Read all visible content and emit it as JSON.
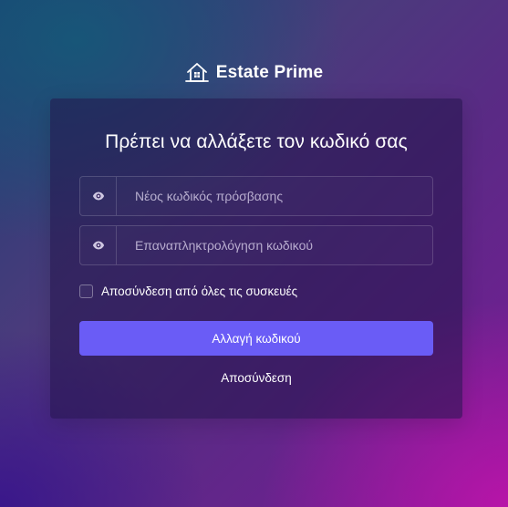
{
  "brand": {
    "name": "Estate Prime",
    "icon": "house-logo-icon"
  },
  "card": {
    "title": "Πρέπει να αλλάξετε τον κωδικό σας",
    "new_password": {
      "placeholder": "Νέος κωδικός πρόσβασης",
      "value": "",
      "icon": "eye-icon"
    },
    "confirm_password": {
      "placeholder": "Επαναπληκτρολόγηση κωδικού",
      "value": "",
      "icon": "eye-icon"
    },
    "logout_all": {
      "label": "Αποσύνδεση από όλες τις συσκευές",
      "checked": false
    },
    "submit_label": "Αλλαγή κωδικού",
    "logout_label": "Αποσύνδεση"
  },
  "colors": {
    "accent": "#6a5cf6",
    "text": "#ffffff"
  }
}
